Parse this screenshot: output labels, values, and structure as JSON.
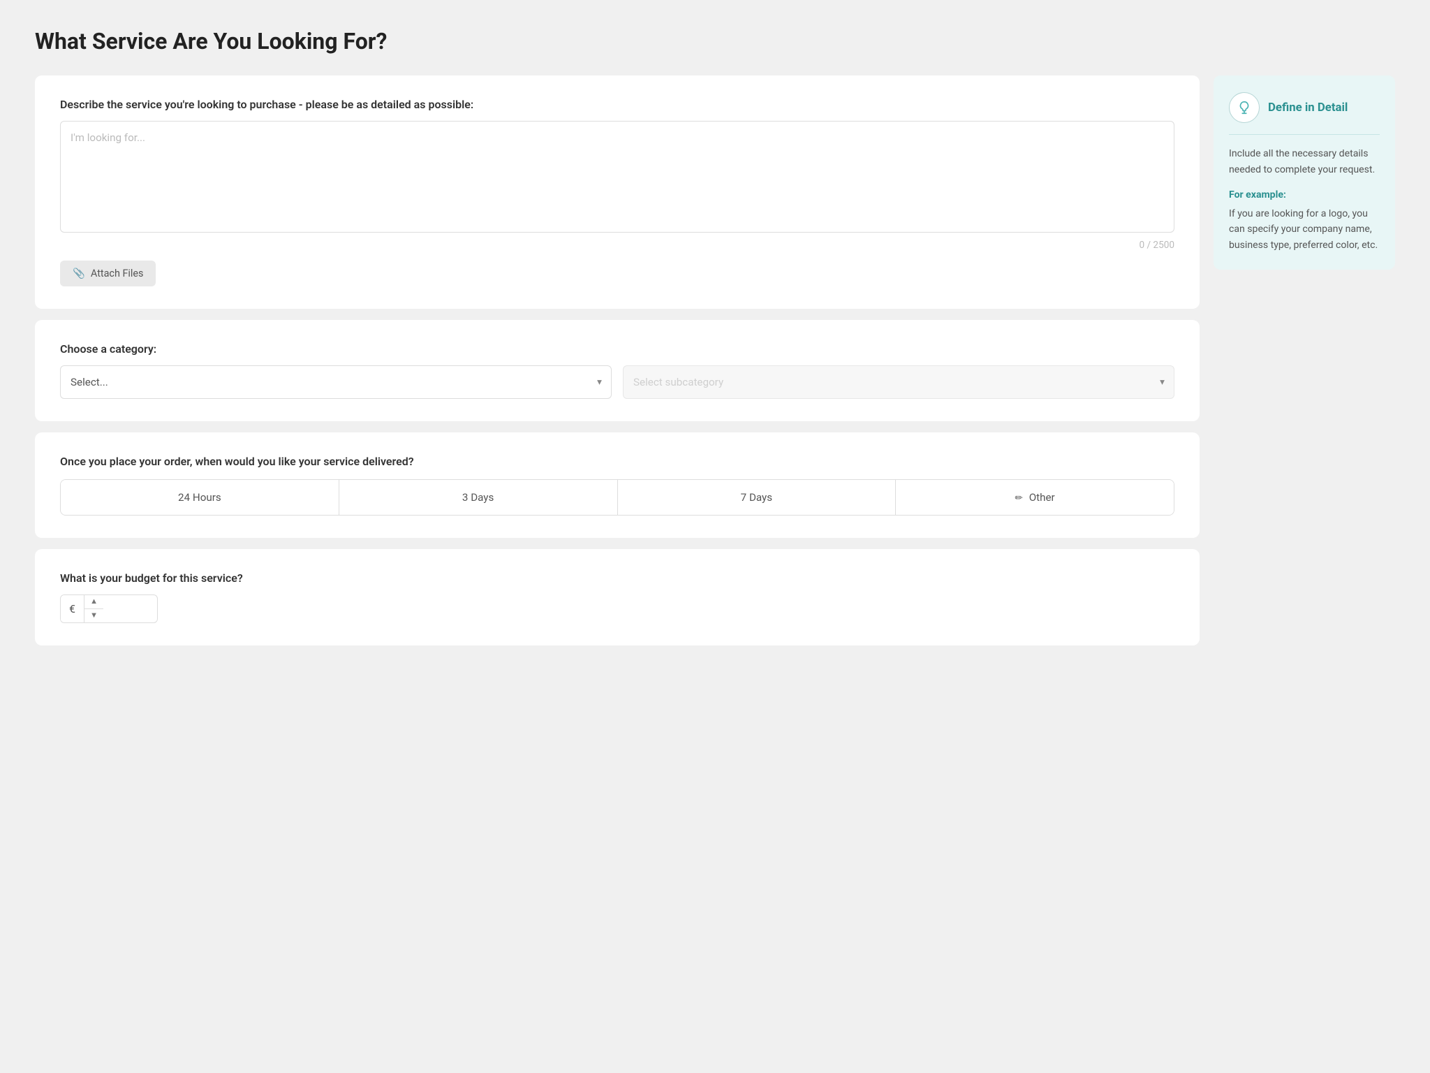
{
  "page": {
    "title": "What Service Are You Looking For?"
  },
  "description_section": {
    "label": "Describe the service you're looking to purchase - please be as detailed as possible:",
    "placeholder": "I'm looking for...",
    "char_count": "0 / 2500",
    "attach_label": "Attach Files"
  },
  "category_section": {
    "label": "Choose a category:",
    "category_placeholder": "Select...",
    "subcategory_placeholder": "Select subcategory"
  },
  "delivery_section": {
    "label": "Once you place your order, when would you like your service delivered?",
    "options": [
      {
        "id": "24h",
        "label": "24 Hours"
      },
      {
        "id": "3d",
        "label": "3 Days"
      },
      {
        "id": "7d",
        "label": "7 Days"
      },
      {
        "id": "other",
        "label": "Other",
        "icon": "✏"
      }
    ]
  },
  "budget_section": {
    "label": "What is your budget for this service?",
    "currency_symbol": "€"
  },
  "sidebar": {
    "title": "Define in Detail",
    "body": "Include all the necessary details needed to complete your request.",
    "example_label": "For example:",
    "example_text": "If you are looking for a logo, you can specify your company name, business type, preferred color, etc."
  },
  "icons": {
    "chevron": "▾",
    "paperclip": "📎",
    "pencil": "✏"
  }
}
